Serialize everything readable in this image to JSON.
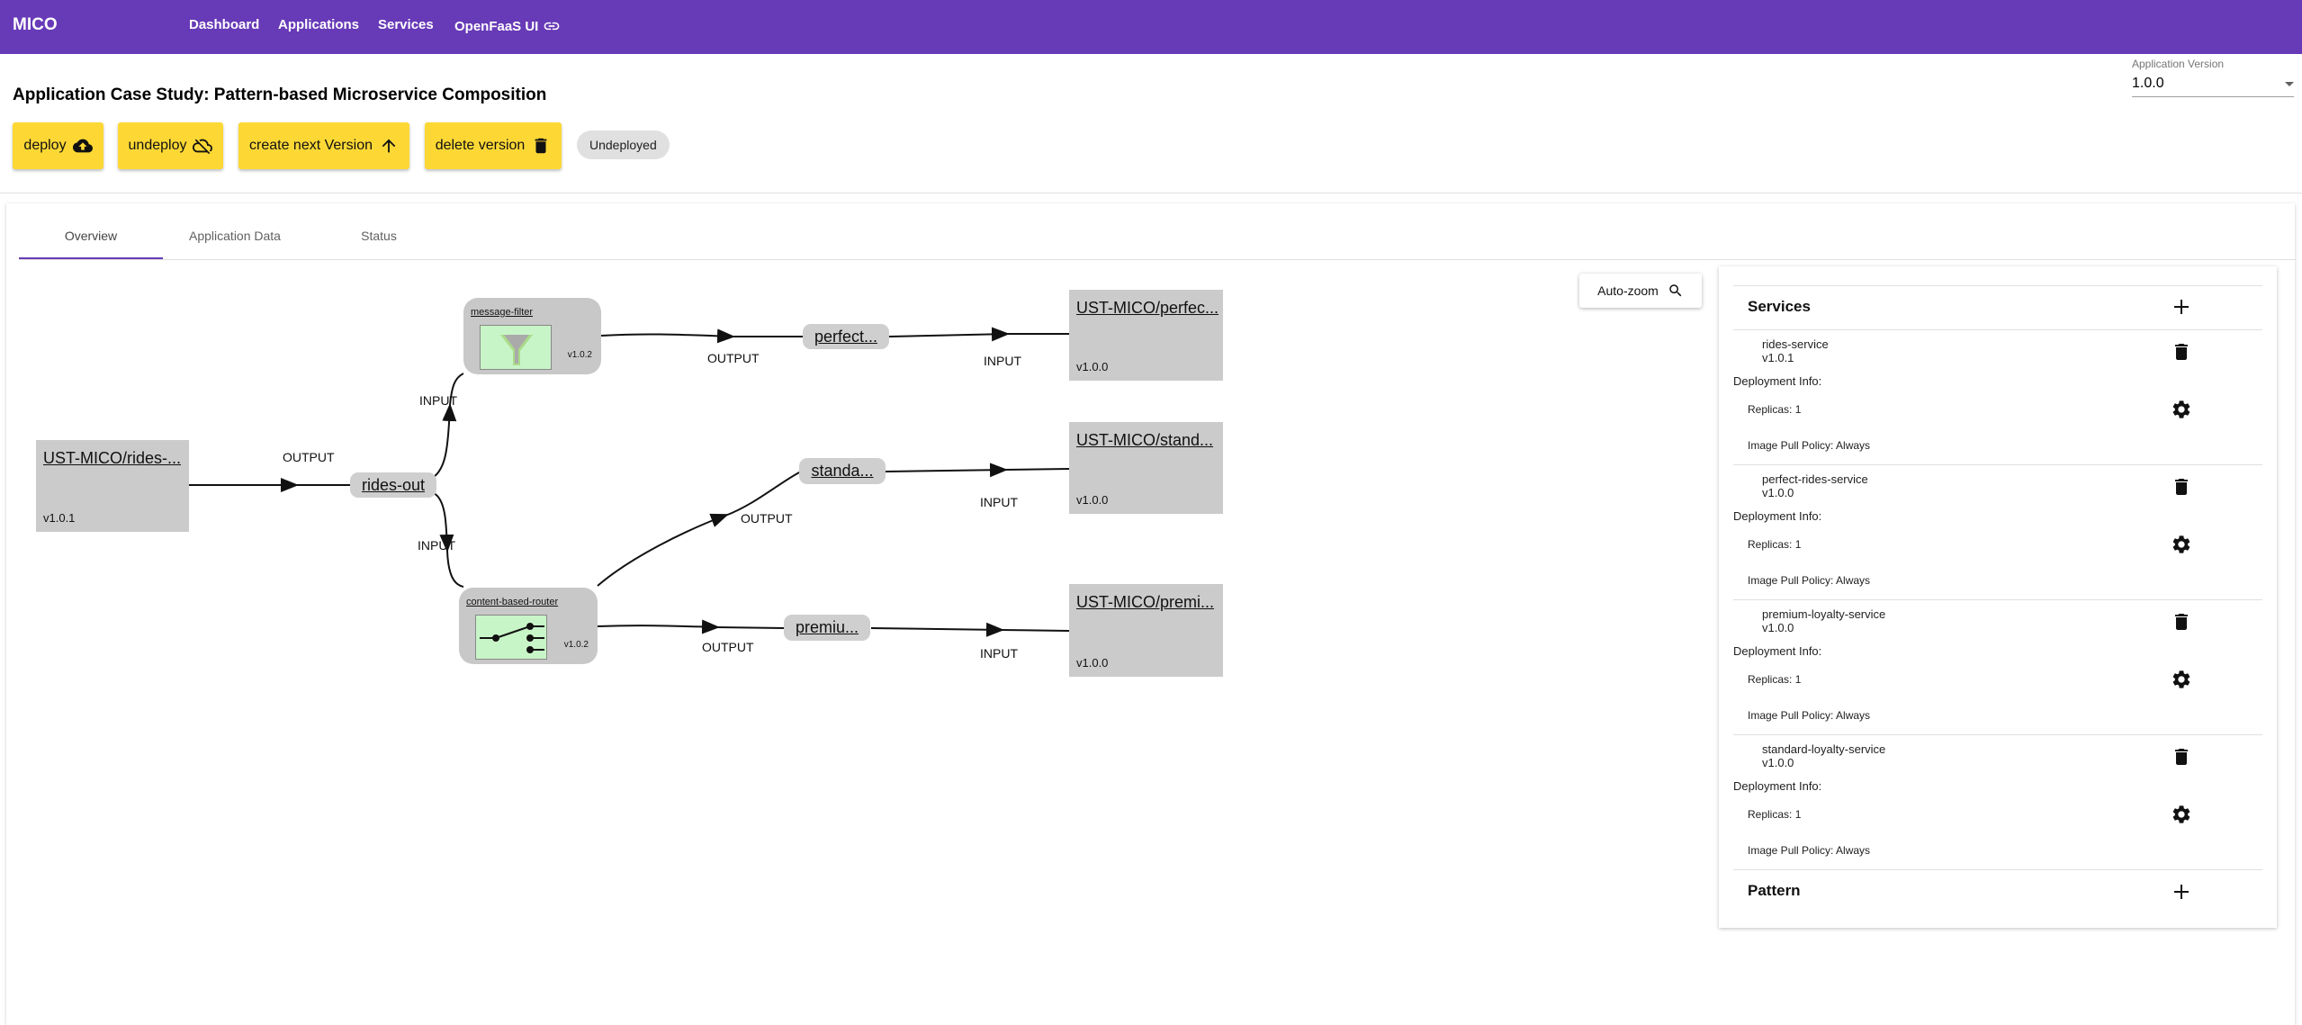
{
  "topbar": {
    "brand": "MICO",
    "nav": [
      "Dashboard",
      "Applications",
      "Services",
      "OpenFaaS UI"
    ],
    "background": "#673ab7"
  },
  "header": {
    "title": "Application Case Study: Pattern-based Microservice Composition",
    "buttons": {
      "deploy": "deploy",
      "undeploy": "undeploy",
      "create_next": "create next Version",
      "delete_version": "delete version"
    },
    "status_chip": "Undeployed",
    "version_select": {
      "label": "Application Version",
      "value": "1.0.0"
    }
  },
  "tabs": [
    "Overview",
    "Application Data",
    "Status"
  ],
  "graph": {
    "auto_zoom": "Auto-zoom",
    "services": {
      "rides": {
        "name": "UST-MICO/rides-...",
        "version": "v1.0.1"
      },
      "perfect": {
        "name": "UST-MICO/perfec...",
        "version": "v1.0.0"
      },
      "standard": {
        "name": "UST-MICO/stand...",
        "version": "v1.0.0"
      },
      "premium": {
        "name": "UST-MICO/premi...",
        "version": "v1.0.0"
      }
    },
    "topics": {
      "rides_out": "rides-out",
      "perfect": "perfect...",
      "standard": "standa...",
      "premium": "premiu..."
    },
    "patterns": {
      "filter": {
        "name": "message-filter",
        "version": "v1.0.2"
      },
      "router": {
        "name": "content-based-router",
        "version": "v1.0.2"
      }
    },
    "edge_labels": {
      "output": "OUTPUT",
      "input": "INPUT"
    }
  },
  "panel": {
    "services_title": "Services",
    "pattern_title": "Pattern",
    "deployment_info_label": "Deployment Info:",
    "services": [
      {
        "name": "rides-service",
        "version": "v1.0.1",
        "replicas": "Replicas: 1",
        "pull_policy": "Image Pull Policy: Always"
      },
      {
        "name": "perfect-rides-service",
        "version": "v1.0.0",
        "replicas": "Replicas: 1",
        "pull_policy": "Image Pull Policy: Always"
      },
      {
        "name": "premium-loyalty-service",
        "version": "v1.0.0",
        "replicas": "Replicas: 1",
        "pull_policy": "Image Pull Policy: Always"
      },
      {
        "name": "standard-loyalty-service",
        "version": "v1.0.0",
        "replicas": "Replicas: 1",
        "pull_policy": "Image Pull Policy: Always"
      }
    ]
  },
  "colors": {
    "accent": "#673ab7",
    "button": "#fdd835",
    "node_gray": "#cbcbcb",
    "pattern_icon_bg": "#c8f5c8"
  }
}
